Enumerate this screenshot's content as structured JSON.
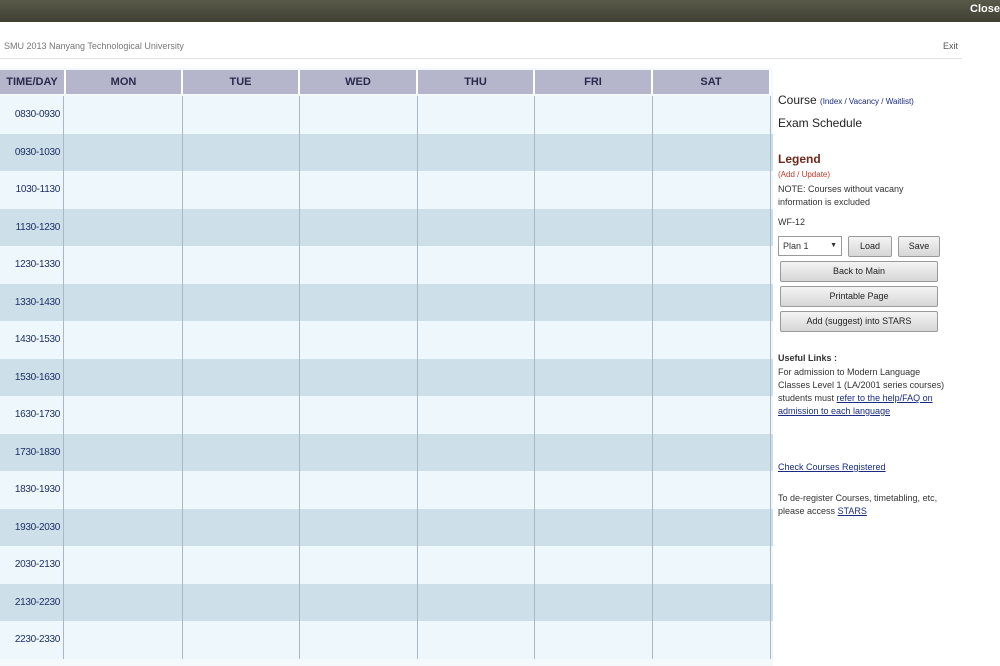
{
  "topbar": {
    "right_label": "Close"
  },
  "titlebar": {
    "left_text": "SMU 2013 Nanyang Technological University",
    "right_link": "Exit"
  },
  "timetable": {
    "header": [
      "TIME/DAY",
      "MON",
      "TUE",
      "WED",
      "THU",
      "FRI",
      "SAT"
    ],
    "times": [
      "0830-0930",
      "0930-1030",
      "1030-1130",
      "1130-1230",
      "1230-1330",
      "1330-1430",
      "1430-1530",
      "1530-1630",
      "1630-1730",
      "1730-1830",
      "1830-1930",
      "1930-2030",
      "2030-2130",
      "2130-2230",
      "2230-2330"
    ]
  },
  "side": {
    "course_label": "Course",
    "course_links": "(Index / Vacancy / Waitlist)",
    "exam_label": "Exam Schedule",
    "legend_title": "Legend",
    "legend_sub": "(Add / Update)",
    "note": "NOTE: Courses without vacany information is excluded",
    "code": "WF-12",
    "select_value": "Plan 1",
    "load_label": "Load",
    "save_label": "Save",
    "back_label": "Back to Main",
    "printable_label": "Printable Page",
    "add_label": "Add (suggest) into STARS",
    "help_title": "Useful Links :",
    "help_text": "For admission to Modern Language Classes Level 1 (LA/2001 series courses) students must",
    "help_link": "refer to the help/FAQ on admission to each language",
    "check_link": "Check Courses Registered",
    "dereg_text": "To de-register Courses, timetabling, etc, please access",
    "dereg_link": "STARS"
  }
}
